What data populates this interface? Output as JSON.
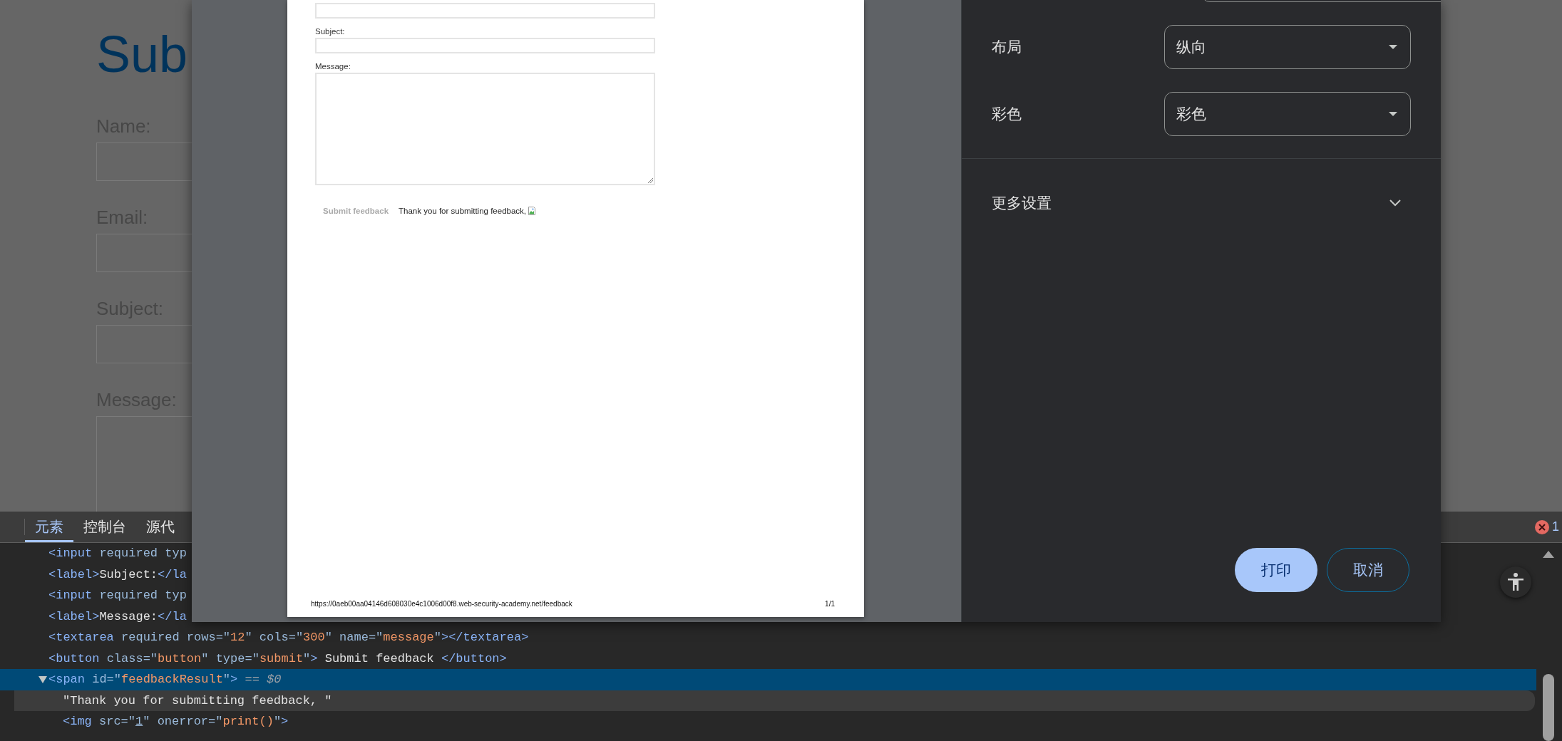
{
  "page": {
    "heading": "Sub",
    "fields": [
      {
        "label": "Name:",
        "kind": "input"
      },
      {
        "label": "Email:",
        "kind": "input"
      },
      {
        "label": "Subject:",
        "kind": "input"
      },
      {
        "label": "Message:",
        "kind": "textarea"
      }
    ]
  },
  "devtools": {
    "tabs": [
      {
        "label": "元素",
        "selected": true
      },
      {
        "label": "控制台",
        "selected": false
      },
      {
        "label": "源代",
        "selected": false
      }
    ],
    "error_count": "1",
    "dom_nodes": [
      {
        "selected": false,
        "hovered": false,
        "tokens": [
          {
            "kind": "tag",
            "text": "<input "
          },
          {
            "kind": "attr",
            "text": "required typ"
          }
        ]
      },
      {
        "selected": false,
        "hovered": false,
        "tokens": [
          {
            "kind": "tag",
            "text": "<label>"
          },
          {
            "kind": "text",
            "text": "Subject:"
          },
          {
            "kind": "tag",
            "text": "</la"
          }
        ]
      },
      {
        "selected": false,
        "hovered": false,
        "tokens": [
          {
            "kind": "tag",
            "text": "<input "
          },
          {
            "kind": "attr",
            "text": "required typ"
          }
        ]
      },
      {
        "selected": false,
        "hovered": false,
        "tokens": [
          {
            "kind": "tag",
            "text": "<label>"
          },
          {
            "kind": "text",
            "text": "Message:"
          },
          {
            "kind": "tag",
            "text": "</la"
          }
        ]
      },
      {
        "selected": false,
        "hovered": false,
        "tokens": [
          {
            "kind": "tag",
            "text": "<textarea "
          },
          {
            "kind": "attr",
            "text": "required rows=\""
          },
          {
            "kind": "value",
            "text": "12"
          },
          {
            "kind": "attr",
            "text": "\" cols=\""
          },
          {
            "kind": "value",
            "text": "300"
          },
          {
            "kind": "attr",
            "text": "\" name=\""
          },
          {
            "kind": "value",
            "text": "message"
          },
          {
            "kind": "attr",
            "text": "\""
          },
          {
            "kind": "tag",
            "text": "></textarea>"
          }
        ]
      },
      {
        "selected": false,
        "hovered": false,
        "tokens": [
          {
            "kind": "tag",
            "text": "<button "
          },
          {
            "kind": "attr",
            "text": "class=\""
          },
          {
            "kind": "value",
            "text": "button"
          },
          {
            "kind": "attr",
            "text": "\" type=\""
          },
          {
            "kind": "value",
            "text": "submit"
          },
          {
            "kind": "attr",
            "text": "\""
          },
          {
            "kind": "tag",
            "text": ">"
          },
          {
            "kind": "text",
            "text": " Submit feedback "
          },
          {
            "kind": "tag",
            "text": "</button>"
          }
        ]
      },
      {
        "selected": true,
        "hovered": false,
        "expanded": true,
        "tokens": [
          {
            "kind": "tag",
            "text": "<span "
          },
          {
            "kind": "attr",
            "text": "id=\""
          },
          {
            "kind": "value",
            "text": "feedbackResult"
          },
          {
            "kind": "attr",
            "text": "\""
          },
          {
            "kind": "tag",
            "text": ">"
          },
          {
            "kind": "note",
            "text": " == $0"
          }
        ],
        "children": [
          {
            "selected": false,
            "hovered": true,
            "tokens": [
              {
                "kind": "text",
                "text": "\"Thank you for submitting feedback, \""
              }
            ]
          },
          {
            "selected": false,
            "hovered": false,
            "tokens": [
              {
                "kind": "tag",
                "text": "<img "
              },
              {
                "kind": "attr",
                "text": "src=\""
              },
              {
                "kind": "link",
                "text": "1"
              },
              {
                "kind": "attr",
                "text": "\" onerror=\""
              },
              {
                "kind": "value",
                "text": "print()"
              },
              {
                "kind": "attr",
                "text": "\""
              },
              {
                "kind": "tag",
                "text": ">"
              }
            ]
          }
        ]
      }
    ]
  },
  "print_dialog": {
    "preview": {
      "fields": [
        {
          "kind": "input"
        },
        {
          "kind": "input",
          "label": "Subject:"
        },
        {
          "kind": "textarea",
          "label": "Message:"
        }
      ],
      "submit_button": "Submit feedback",
      "result_text": "Thank you for submitting feedback,",
      "footer_url": "https://0aeb00aa04146d608030e4c1006d00f8.web-security-academy.net/feedback",
      "page_number": "1/1"
    },
    "settings": [
      {
        "label": "布局",
        "value": "纵向"
      },
      {
        "label": "彩色",
        "value": "彩色"
      }
    ],
    "more_settings": {
      "label": "更多设置",
      "expanded": false
    },
    "buttons": [
      {
        "label": "打印",
        "kind": "primary"
      },
      {
        "label": "取消",
        "kind": "secondary"
      }
    ]
  }
}
